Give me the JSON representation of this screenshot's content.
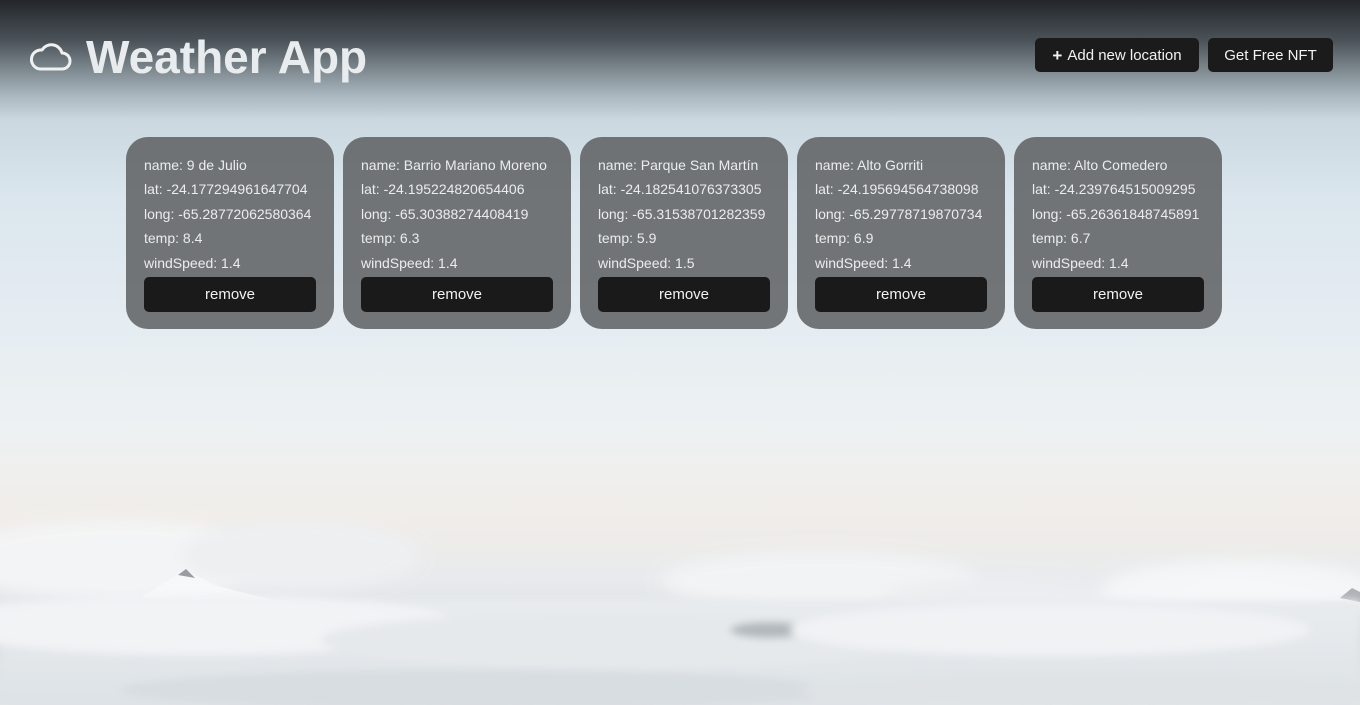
{
  "header": {
    "title": "Weather App",
    "icon": "cloud-icon",
    "add_location_label": "Add new location",
    "nft_label": "Get Free NFT"
  },
  "locations": [
    {
      "name": "name: 9 de Julio",
      "lat": "lat: -24.177294961647704",
      "long": "long: -65.28772062580364",
      "temp": "temp: 8.4",
      "windSpeed": "windSpeed: 1.4",
      "remove_label": "remove"
    },
    {
      "name": "name: Barrio Mariano Moreno",
      "lat": "lat: -24.195224820654406",
      "long": "long: -65.30388274408419",
      "temp": "temp: 6.3",
      "windSpeed": "windSpeed: 1.4",
      "remove_label": "remove"
    },
    {
      "name": "name: Parque San Martín",
      "lat": "lat: -24.182541076373305",
      "long": "long: -65.31538701282359",
      "temp": "temp: 5.9",
      "windSpeed": "windSpeed: 1.5",
      "remove_label": "remove"
    },
    {
      "name": "name: Alto Gorriti",
      "lat": "lat: -24.195694564738098",
      "long": "long: -65.29778719870734",
      "temp": "temp: 6.9",
      "windSpeed": "windSpeed: 1.4",
      "remove_label": "remove"
    },
    {
      "name": "name: Alto Comedero",
      "lat": "lat: -24.239764515009295",
      "long": "long: -65.26361848745891",
      "temp": "temp: 6.7",
      "windSpeed": "windSpeed: 1.4",
      "remove_label": "remove"
    }
  ],
  "colors": {
    "button_bg": "#1b1b1b",
    "card_bg": "#585a5c",
    "title_text": "#e9ecee"
  }
}
